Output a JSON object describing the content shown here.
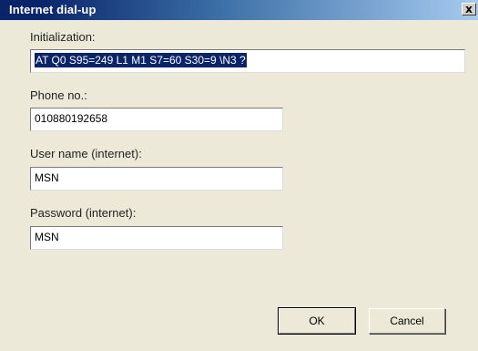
{
  "window": {
    "title": "Internet dial-up",
    "close_glyph": "x"
  },
  "fields": {
    "initialization": {
      "label": "Initialization:",
      "value": "AT Q0 S95=249 L1 M1 S7=60 S30=9 \\N3 ?"
    },
    "phone": {
      "label": "Phone no.:",
      "value": "010880192658"
    },
    "username": {
      "label": "User name (internet):",
      "value": "MSN"
    },
    "password": {
      "label": "Password (internet):",
      "value": "MSN"
    }
  },
  "buttons": {
    "ok": "OK",
    "cancel": "Cancel"
  },
  "colors": {
    "titlebar_start": "#0a246a",
    "titlebar_end": "#a6caf0",
    "dialog_bg": "#ece9d8",
    "selection_bg": "#0a246a"
  }
}
